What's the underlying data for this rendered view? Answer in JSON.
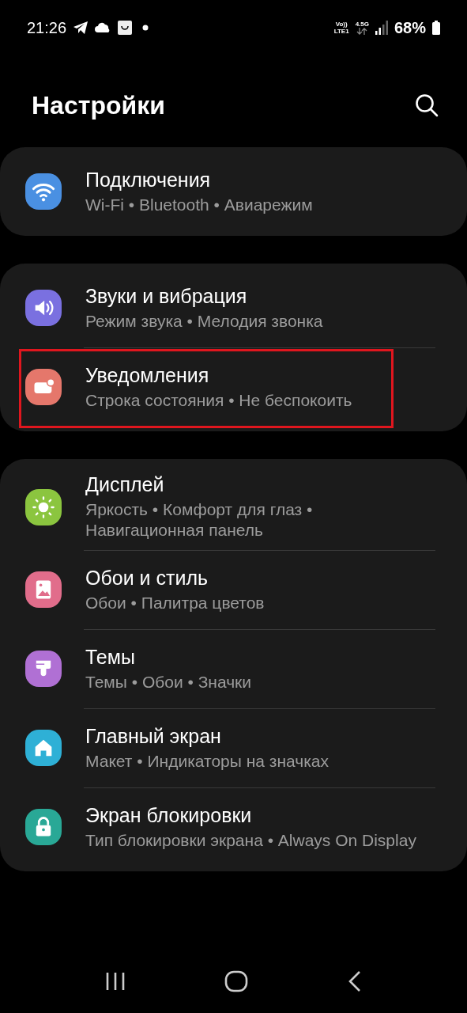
{
  "status_bar": {
    "time": "21:26",
    "volte": "Vo))",
    "lte": "LTE1",
    "network": "4.5G",
    "battery": "68%"
  },
  "header": {
    "title": "Настройки"
  },
  "groups": [
    {
      "items": [
        {
          "kind": "wifi",
          "color": "#4a90e2",
          "title": "Подключения",
          "subtitle": "Wi-Fi • Bluetooth • Авиарежим",
          "highlighted": false
        }
      ]
    },
    {
      "items": [
        {
          "kind": "sound",
          "color": "#7a70e0",
          "title": "Звуки и вибрация",
          "subtitle": "Режим звука • Мелодия звонка",
          "highlighted": false
        },
        {
          "kind": "notification",
          "color": "#e5776b",
          "title": "Уведомления",
          "subtitle": "Строка состояния • Не беспокоить",
          "highlighted": true
        }
      ]
    },
    {
      "items": [
        {
          "kind": "display",
          "color": "#8bc53f",
          "title": "Дисплей",
          "subtitle": "Яркость • Комфорт для глаз • Навигационная панель",
          "highlighted": false
        },
        {
          "kind": "wallpaper",
          "color": "#e16d8b",
          "title": "Обои и стиль",
          "subtitle": "Обои • Палитра цветов",
          "highlighted": false
        },
        {
          "kind": "themes",
          "color": "#b070d4",
          "title": "Темы",
          "subtitle": "Темы • Обои • Значки",
          "highlighted": false
        },
        {
          "kind": "home",
          "color": "#2eb0d6",
          "title": "Главный экран",
          "subtitle": "Макет • Индикаторы на значках",
          "highlighted": false
        },
        {
          "kind": "lock",
          "color": "#29a896",
          "title": "Экран блокировки",
          "subtitle": "Тип блокировки экрана • Always On Display",
          "highlighted": false
        }
      ]
    }
  ]
}
